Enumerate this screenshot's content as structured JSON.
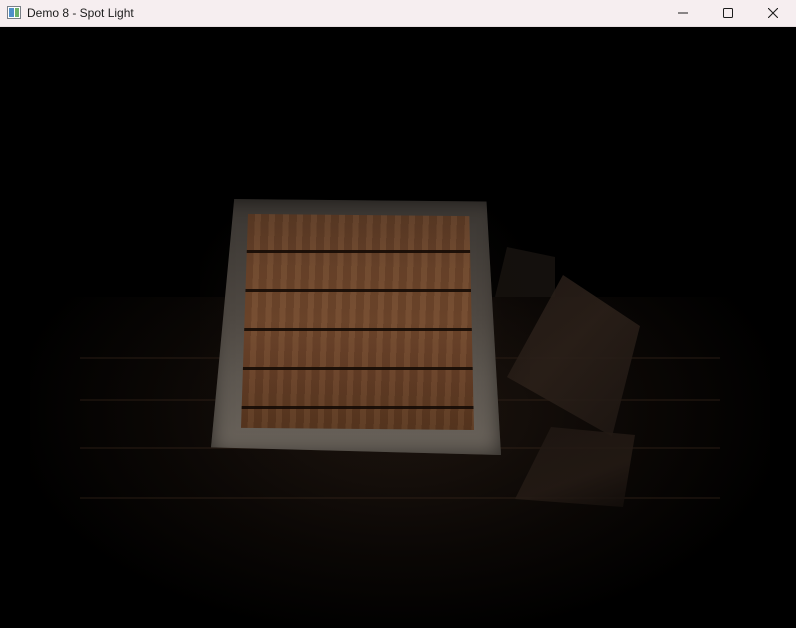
{
  "window": {
    "title": "Demo 8 - Spot Light",
    "icon": "app-window-icon",
    "controls": {
      "minimize_icon": "minimize-icon",
      "maximize_icon": "maximize-icon",
      "close_icon": "close-icon"
    }
  },
  "colors": {
    "titlebar_bg": "#f6eef0",
    "viewport_bg": "#000000",
    "crate_wood": "#6b442a",
    "crate_metal": "#5d5750"
  }
}
